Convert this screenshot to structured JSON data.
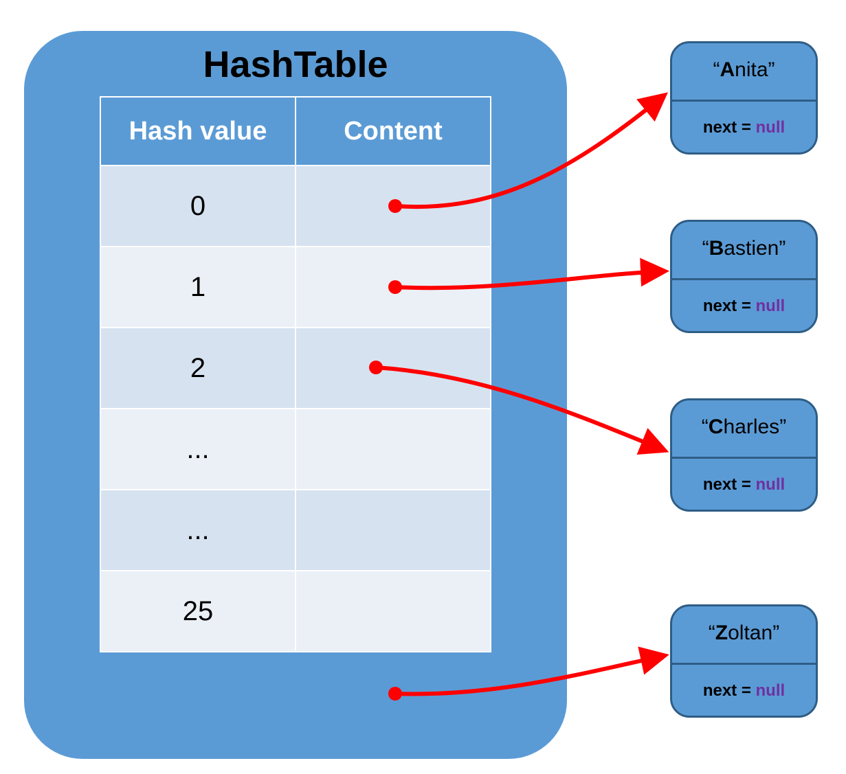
{
  "title": "HashTable",
  "table": {
    "headers": {
      "hash": "Hash value",
      "content": "Content"
    },
    "rows": [
      {
        "hash": "0",
        "content": ""
      },
      {
        "hash": "1",
        "content": ""
      },
      {
        "hash": "2",
        "content": ""
      },
      {
        "hash": "...",
        "content": ""
      },
      {
        "hash": "...",
        "content": ""
      },
      {
        "hash": "25",
        "content": ""
      }
    ]
  },
  "nodes": {
    "a": {
      "first": "A",
      "rest": "nita",
      "next_kw": "next = ",
      "next_val": "null"
    },
    "b": {
      "first": "B",
      "rest": "astien",
      "next_kw": "next = ",
      "next_val": "null"
    },
    "c": {
      "first": "C",
      "rest": "harles",
      "next_kw": "next = ",
      "next_val": "null"
    },
    "d": {
      "first": "Z",
      "rest": "oltan",
      "next_kw": "next = ",
      "next_val": "null"
    }
  },
  "colors": {
    "box": "#5b9bd5",
    "border": "#2e5d86",
    "arrow": "#ff0000",
    "null": "#7030a0"
  }
}
